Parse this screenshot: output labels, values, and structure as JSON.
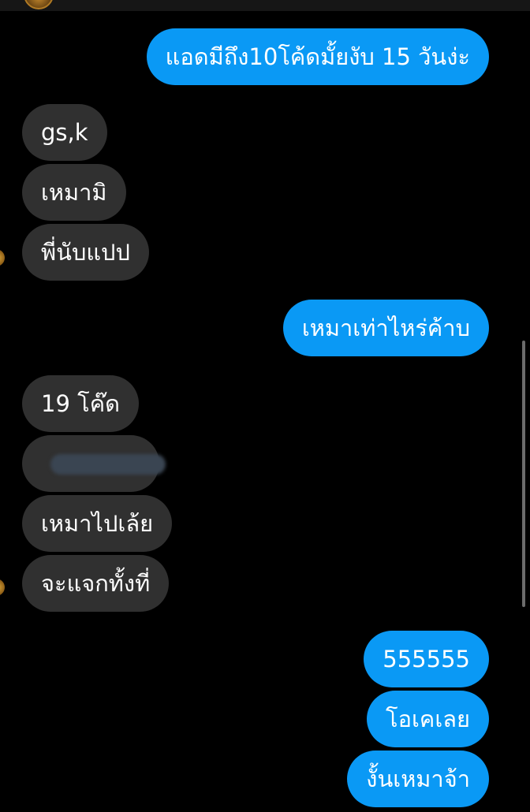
{
  "messages": [
    {
      "side": "sent",
      "text": "แอดมีถึง10โค้ดมั้ยงับ 15 วันง่ะ"
    },
    {
      "side": "received",
      "text": "gs,k"
    },
    {
      "side": "received",
      "text": "เหมามิ"
    },
    {
      "side": "received",
      "text": "พี่นับแปป"
    },
    {
      "side": "sent",
      "text": "เหมาเท่าไหร่ค้าบ"
    },
    {
      "side": "received",
      "text": "19 โค๊ด"
    },
    {
      "side": "received",
      "text": ""
    },
    {
      "side": "received",
      "text": "เหมาไปเล้ย"
    },
    {
      "side": "received",
      "text": "จะแจกทั้งที่"
    },
    {
      "side": "sent",
      "text": "555555"
    },
    {
      "side": "sent",
      "text": "โอเคเลย"
    },
    {
      "side": "sent",
      "text": "งั้นเหมาจ้า"
    }
  ],
  "colors": {
    "background": "#000000",
    "sent_bubble": "#0a99f5",
    "received_bubble": "#303030",
    "text": "#ffffff"
  },
  "icons": {
    "avatar": "contact-avatar-icon"
  }
}
